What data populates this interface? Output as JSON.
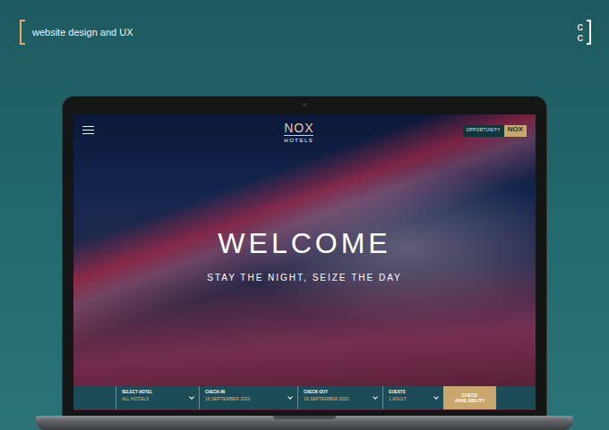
{
  "header": {
    "title": "website design and UX"
  },
  "logo": {
    "letters": [
      "c",
      "c"
    ]
  },
  "site": {
    "brand": {
      "name": "NOX",
      "sub": "HOTELS"
    },
    "badge": {
      "label": "OPPORTUNITY",
      "brand": "NOX"
    },
    "hero": {
      "title": "WELCOME",
      "subtitle": "STAY THE NIGHT, SEIZE THE DAY"
    },
    "booking": {
      "fields": [
        {
          "label": "SELECT HOTEL",
          "value": "ALL HOTELS"
        },
        {
          "label": "CHECK-IN",
          "value": "18 SEPTEMBER 2020"
        },
        {
          "label": "CHECK-OUT",
          "value": "19 SEPTEMBER 2020"
        },
        {
          "label": "GUESTS",
          "value": "1 ADULT"
        }
      ],
      "button": [
        "CHECK",
        "AVAILABILITY"
      ]
    }
  }
}
